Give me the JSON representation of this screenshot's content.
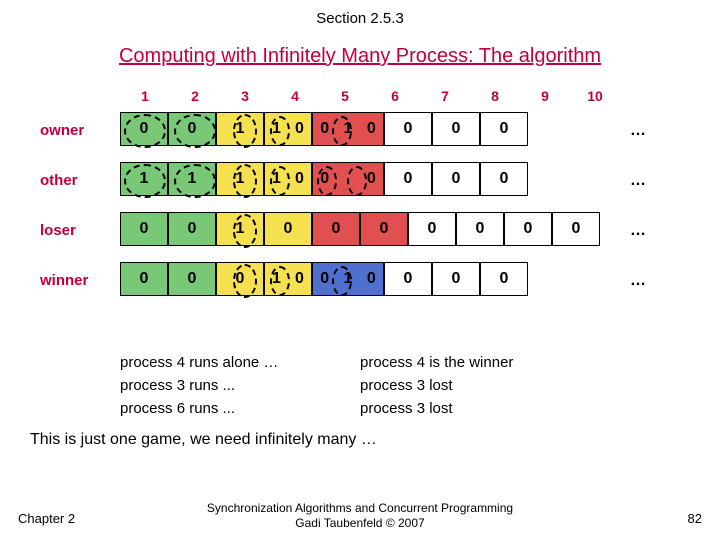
{
  "section": "Section 2.5.3",
  "title": "Computing with Infinitely Many Process: The algorithm",
  "col_headers": [
    "1",
    "2",
    "3",
    "4",
    "5",
    "6",
    "7",
    "8",
    "9",
    "10"
  ],
  "rows": {
    "owner": {
      "label": "owner",
      "cells": [
        [
          "0"
        ],
        [
          "0"
        ],
        [
          "1"
        ],
        [
          "1",
          "0"
        ],
        [
          "0",
          "1",
          "0"
        ],
        [
          "0"
        ],
        [
          "0"
        ],
        [
          "0"
        ]
      ],
      "colors": [
        "green",
        "green",
        "yellow",
        "yellow",
        "red",
        "white",
        "white",
        "white"
      ]
    },
    "other": {
      "label": "other",
      "cells": [
        [
          "1"
        ],
        [
          "1"
        ],
        [
          "1"
        ],
        [
          "1",
          "0"
        ],
        [
          "0",
          " ",
          "0"
        ],
        [
          "0"
        ],
        [
          "0"
        ],
        [
          "0"
        ]
      ],
      "colors": [
        "green",
        "green",
        "yellow",
        "yellow",
        "red",
        "white",
        "white",
        "white"
      ]
    },
    "loser": {
      "label": "loser",
      "cells": [
        [
          "0"
        ],
        [
          "0"
        ],
        [
          "1"
        ],
        [
          "0"
        ],
        [
          "0"
        ],
        [
          "0"
        ],
        [
          "0"
        ],
        [
          "0"
        ],
        [
          "0"
        ],
        [
          "0"
        ]
      ],
      "colors": [
        "green",
        "green",
        "yellow",
        "yellow",
        "red",
        "red",
        "white",
        "white",
        "white",
        "white"
      ]
    },
    "winner": {
      "label": "winner",
      "cells": [
        [
          "0"
        ],
        [
          "0"
        ],
        [
          "0"
        ],
        [
          "1",
          "0"
        ],
        [
          "0",
          "1",
          "0"
        ],
        [
          "0"
        ],
        [
          "0"
        ],
        [
          "0"
        ]
      ],
      "colors": [
        "green",
        "green",
        "yellow",
        "yellow",
        "blue",
        "white",
        "white",
        "white"
      ]
    }
  },
  "dots": "…",
  "trace": [
    [
      "process 4 runs alone …",
      "process 4 is the winner"
    ],
    [
      "process 3 runs ...",
      "process 3 lost"
    ],
    [
      "process 6 runs ...",
      "process 3 lost"
    ]
  ],
  "summary": "This is just one game, we need infinitely many …",
  "footer": {
    "left": "Chapter 2",
    "center_l1": "Synchronization Algorithms and Concurrent Programming",
    "center_l2": "Gadi Taubenfeld © 2007",
    "right": "82"
  }
}
